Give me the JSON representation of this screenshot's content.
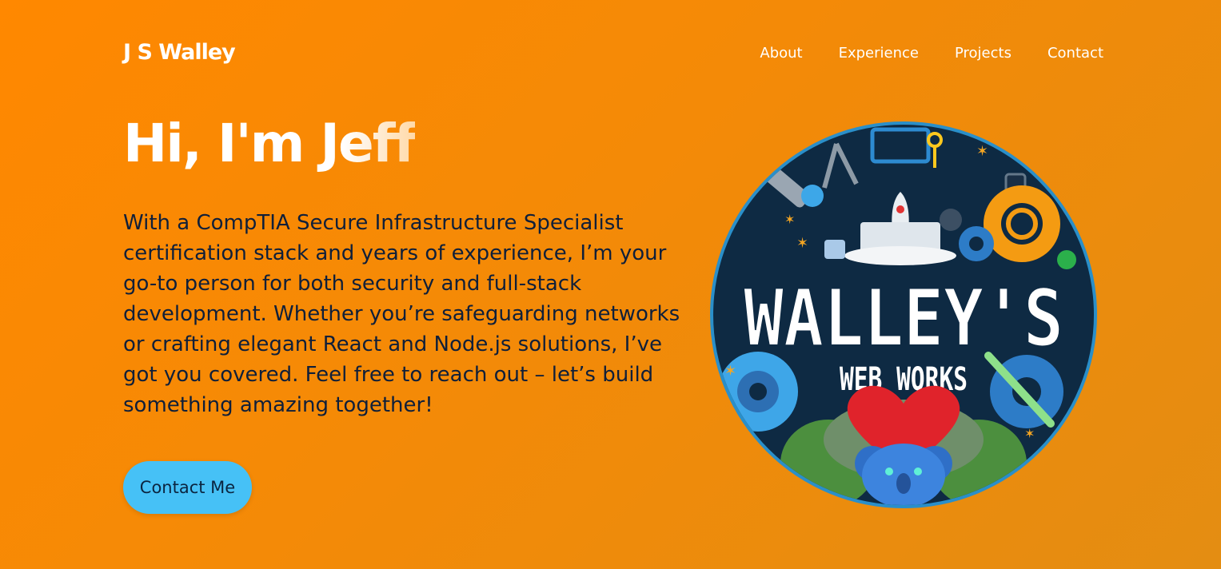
{
  "nav": {
    "brand": "J S Walley",
    "links": [
      "About",
      "Experience",
      "Projects",
      "Contact"
    ]
  },
  "hero": {
    "title": "Hi, I'm Jeff",
    "description": "With a CompTIA Secure Infrastructure Specialist certification stack and years of experience, I’m your go-to person for both security and full-stack development. Whether you’re safeguarding networks or crafting elegant React and Node.js solutions, I’ve got you covered. Feel free to reach out – let’s build something amazing together!",
    "cta_label": "Contact Me"
  },
  "logo": {
    "title": "WALLEY'S",
    "subtitle": "WEB WORKS"
  },
  "colors": {
    "background": "#ff8800",
    "accent": "#46c1f6",
    "text_dark": "#0f1f3a",
    "logo_bg": "#0e2a43"
  }
}
